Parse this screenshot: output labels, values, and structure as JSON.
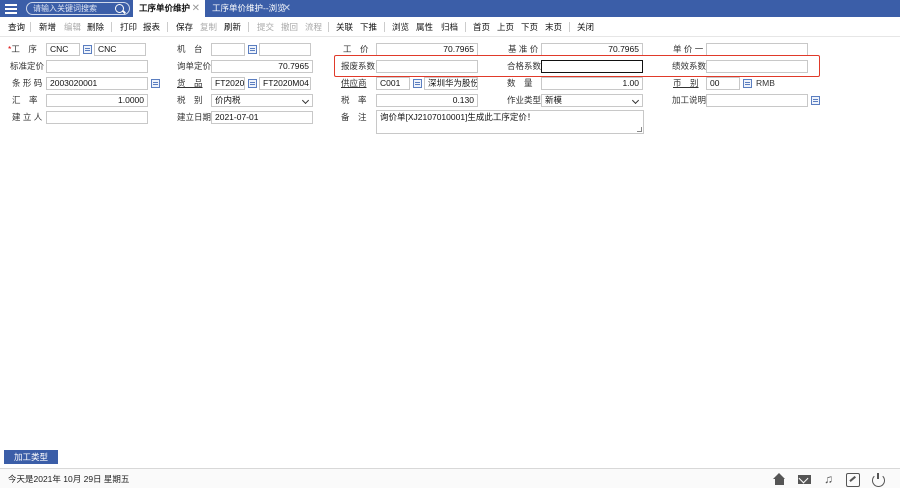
{
  "header": {
    "search_placeholder": "请输入关键词搜索",
    "tabs": [
      {
        "label": "工序单价维护",
        "active": true
      },
      {
        "label": "工序单价维护--浏览",
        "active": false
      }
    ]
  },
  "toolbar": {
    "query": "查询",
    "add": "新增",
    "edit": "编辑",
    "delete": "删除",
    "print": "打印",
    "report": "报表",
    "save": "保存",
    "copy": "复制",
    "refresh": "刷新",
    "submit": "提交",
    "withdraw": "撤回",
    "flow": "流程",
    "link": "关联",
    "push": "下推",
    "browse": "浏览",
    "attr": "属性",
    "archive": "归档",
    "first": "首页",
    "prev": "上页",
    "next": "下页",
    "last": "末页",
    "close": "关闭"
  },
  "form": {
    "process_label": "工　序",
    "process_code": "CNC",
    "process_name": "CNC",
    "machine_label": "机　台",
    "machine_code": "",
    "machine_name": "",
    "labor_price_label": "工　价",
    "labor_price": "70.7965",
    "base_price_label": "基 准 价",
    "base_price": "70.7965",
    "unit_price1_label": "单 价 一",
    "unit_price1": "",
    "std_price_label": "标准定价",
    "std_price": "",
    "inquiry_price_label": "询单定价",
    "inquiry_price": "70.7965",
    "scrap_coef_label": "报废系数",
    "scrap_coef": "",
    "qualified_coef_label": "合格系数",
    "qualified_coef": "",
    "perf_coef_label": "绩效系数",
    "perf_coef": "",
    "barcode_label": "条 形 码",
    "barcode": "2003020001",
    "goods_label": "货　品",
    "goods_code": "FT2020M04",
    "goods_name": "FT2020M04",
    "supplier_label": "供应商",
    "supplier_code": "C001",
    "supplier_name": "深圳华为股份有限公司",
    "qty_label": "数　量",
    "qty": "1.00",
    "currency_label": "币　别",
    "currency_code": "00",
    "currency_name": "RMB",
    "exchange_label": "汇　率",
    "exchange": "1.0000",
    "tax_type_label": "税　别",
    "tax_type": "价内税",
    "tax_rate_label": "税　率",
    "tax_rate": "0.130",
    "op_type_label": "作业类型",
    "op_type": "新模",
    "process_note_label": "加工说明",
    "process_note": "",
    "creator_label": "建 立 人",
    "creator": "",
    "create_date_label": "建立日期",
    "create_date": "2021-07-01",
    "remark_label": "备　注",
    "remark": "询价单[XJ2107010001]生成此工序定价！"
  },
  "bottom_tab": "加工类型",
  "status": "今天是2021年 10月 29日 星期五"
}
